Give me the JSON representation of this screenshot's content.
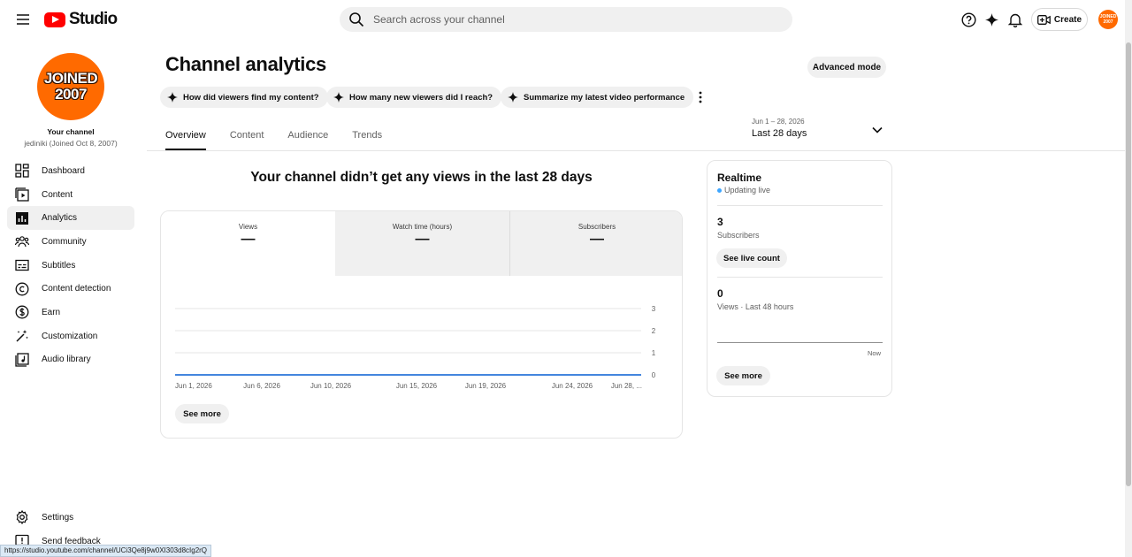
{
  "header": {
    "logo_text": "Studio",
    "search_placeholder": "Search across your channel",
    "create_label": "Create",
    "avatar_text": "JOINED 2007"
  },
  "sidebar": {
    "avatar_line1": "JOINED",
    "avatar_line2": "2007",
    "your_channel": "Your channel",
    "channel_sub": "jediniki (Joined Oct 8, 2007)",
    "items": [
      {
        "label": "Dashboard",
        "icon": "dashboard-icon"
      },
      {
        "label": "Content",
        "icon": "content-icon"
      },
      {
        "label": "Analytics",
        "icon": "analytics-icon",
        "active": true
      },
      {
        "label": "Community",
        "icon": "community-icon"
      },
      {
        "label": "Subtitles",
        "icon": "subtitles-icon"
      },
      {
        "label": "Content detection",
        "icon": "copyright-icon"
      },
      {
        "label": "Earn",
        "icon": "dollar-icon"
      },
      {
        "label": "Customization",
        "icon": "magic-wand-icon"
      },
      {
        "label": "Audio library",
        "icon": "audio-library-icon"
      }
    ],
    "bottom_items": [
      {
        "label": "Settings",
        "icon": "gear-icon"
      },
      {
        "label": "Send feedback",
        "icon": "feedback-icon"
      }
    ]
  },
  "status_bar_url": "https://studio.youtube.com/channel/UCi3Qe8j9w0XI303d8cIg2rQ",
  "main": {
    "title": "Channel analytics",
    "advanced_mode": "Advanced mode",
    "chips": [
      "How did viewers find my content?",
      "How many new viewers did I reach?",
      "Summarize my latest video performance"
    ],
    "tabs": [
      "Overview",
      "Content",
      "Audience",
      "Trends"
    ],
    "active_tab": "Overview",
    "date_range_small": "Jun 1 – 28, 2026",
    "date_range_big": "Last 28 days",
    "headline": "Your channel didn’t get any views in the last 28 days",
    "metrics": [
      {
        "label": "Views",
        "value": "—"
      },
      {
        "label": "Watch time (hours)",
        "value": "—"
      },
      {
        "label": "Subscribers",
        "value": "—"
      }
    ],
    "see_more": "See more"
  },
  "chart_data": {
    "type": "line",
    "x": [
      "Jun 1, 2026",
      "Jun 6, 2026",
      "Jun 10, 2026",
      "Jun 15, 2026",
      "Jun 19, 2026",
      "Jun 24, 2026",
      "Jun 28, ..."
    ],
    "series": [
      {
        "values": [
          0,
          0,
          0,
          0,
          0,
          0,
          0
        ]
      }
    ],
    "yticks": [
      0,
      1,
      2,
      3
    ],
    "ylim": [
      0,
      3
    ],
    "grid": true,
    "line_color": "#065fd4"
  },
  "realtime": {
    "title": "Realtime",
    "live_text": "Updating live",
    "subscribers_value": "3",
    "subscribers_label": "Subscribers",
    "see_live_count": "See live count",
    "views_value": "0",
    "views_label": "Views · Last 48 hours",
    "now_label": "Now",
    "see_more": "See more"
  }
}
